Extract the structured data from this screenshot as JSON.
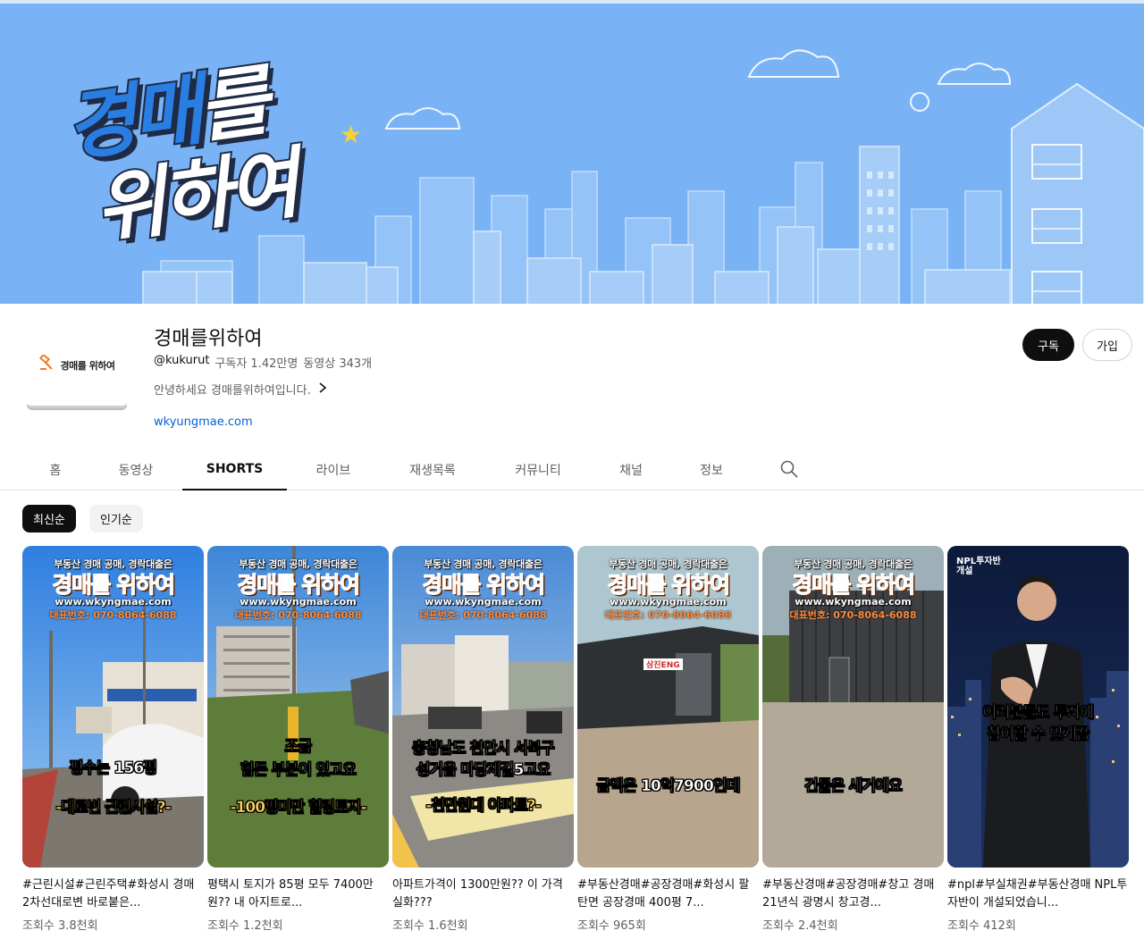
{
  "banner": {
    "title_line1_a": "경매",
    "title_line1_b": "를",
    "title_line2": "위하여",
    "star": "★"
  },
  "channel": {
    "avatar_text": "경매를 위하여",
    "avatar_icon": "gavel-icon",
    "name": "경매를위하여",
    "handle": "@kukurut",
    "subscribers": "구독자 1.42만명",
    "videos": "동영상 343개",
    "description": "안녕하세요 경매를위하여입니다.",
    "link": "wkyungmae.com",
    "subscribe_label": "구독",
    "join_label": "가입"
  },
  "tabs": [
    {
      "label": "홈"
    },
    {
      "label": "동영상"
    },
    {
      "label": "SHORTS",
      "active": true
    },
    {
      "label": "라이브"
    },
    {
      "label": "재생목록"
    },
    {
      "label": "커뮤니티"
    },
    {
      "label": "채널"
    },
    {
      "label": "정보"
    }
  ],
  "chips": {
    "latest": "최신순",
    "popular": "인기순"
  },
  "thumb_common": {
    "top": "부동산 경매 공매, 경락대출은",
    "title": "경매를 위하여",
    "url": "www.wkyngmae.com",
    "phone": "대표번호: 070-8064-6088"
  },
  "shorts": [
    {
      "caption1": "평수는 156평",
      "caption2": "-대로변 근린시설?-",
      "title": "#근린시설#근린주택#화성시 경매 2차선대로변 바로붙은...",
      "views": "조회수 3.8천회"
    },
    {
      "caption1": "조금",
      "caption1b": "힘든 부분이 있고요",
      "caption2": "-100평미만 힐링토지-",
      "title": "평택시 토지가 85평 모두 7400만원?? 내 아지트로...",
      "views": "조회수 1.2천회"
    },
    {
      "caption1": "충청남도 천안시 서북구",
      "caption1b": "성거읍 마당재길5고요",
      "caption2": "-천만원대 아파트?-",
      "title": "아파트가격이 1300만원?? 이 가격 실화???",
      "views": "조회수 1.6천회"
    },
    {
      "caption1": "금액은 10억7900인데",
      "sign": "삼진ENG",
      "title": "#부동산경매#공장경매#화성시 팔탄면 공장경매 400평 7...",
      "views": "조회수 965회"
    },
    {
      "caption1": "건물은 새거예요",
      "title": "#부동산경매#공장경매#창고 경매 21년식 광명시 창고경...",
      "views": "조회수 2.4천회"
    },
    {
      "npl_tag_1": "NPL투자반",
      "npl_tag_2": "개설",
      "caption1": "여러분들도 투자에",
      "caption1b": "참여할 수 있게끔",
      "title": "#npl#부실채권#부동산경매 NPL투자반이 개설되었습니...",
      "views": "조회수 412회"
    }
  ]
}
